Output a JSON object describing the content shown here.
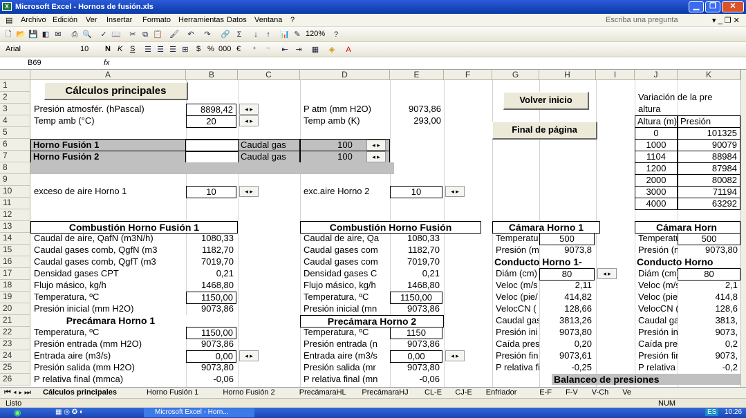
{
  "window": {
    "title": "Microsoft Excel - Hornos de fusión.xls",
    "min": "▁",
    "max": "❐",
    "close": "✕"
  },
  "menu": [
    "Archivo",
    "Edición",
    "Ver",
    "Insertar",
    "Formato",
    "Herramientas",
    "Datos",
    "Ventana",
    "?"
  ],
  "help_placeholder": "Escriba una pregunta",
  "toolbar": {
    "zoom": "120%",
    "icons": [
      "new-icon",
      "open-icon",
      "save-icon",
      "permission-icon",
      "email-icon",
      "print-icon",
      "print-preview-icon",
      "spelling-icon",
      "research-icon",
      "cut-icon",
      "copy-icon",
      "paste-icon",
      "format-painter-icon",
      "undo-icon",
      "redo-icon",
      "hyperlink-icon",
      "sum-icon",
      "sort-asc-icon",
      "sort-desc-icon",
      "chart-icon",
      "drawing-icon"
    ]
  },
  "format": {
    "font": "Arial",
    "size": "10",
    "bold": "N",
    "italic": "K",
    "underline": "S",
    "currency": "$",
    "percent": "%",
    "thousands": "000",
    "euro": "€"
  },
  "formula": {
    "namebox": "B69",
    "fx": "fx",
    "content": ""
  },
  "columns": [
    "A",
    "B",
    "C",
    "D",
    "E",
    "F",
    "G",
    "H",
    "I",
    "J",
    "K"
  ],
  "rows": [
    "1",
    "2",
    "3",
    "4",
    "5",
    "6",
    "7",
    "8",
    "9",
    "10",
    "11",
    "12",
    "13",
    "14",
    "15",
    "16",
    "17",
    "18",
    "19",
    "20",
    "21",
    "22",
    "23",
    "24",
    "25",
    "26"
  ],
  "cells": {
    "title": "Cálculos principales",
    "volver": "Volver inicio",
    "final": "Final de página",
    "a3": "Presión atmosfér. (hPascal)",
    "b3": "8898,42",
    "d3": "P atm (mm H2O)",
    "e3": "9073,86",
    "a4": "Temp amb (°C)",
    "b4": "20",
    "d4": "Temp amb (K)",
    "e4": "293,00",
    "a6": "Horno Fusión 1",
    "c6": "Caudal gas",
    "e6": "100",
    "a7": "Horno Fusión 2",
    "c7": "Caudal gas",
    "e7": "100",
    "a10": "exceso de aire Horno 1",
    "b10": "10",
    "d10": "exc.aire Horno 2",
    "e10": "10",
    "j2": "Variación de la pre",
    "j3": "altura",
    "j4": "Altura (m)",
    "k4": "Presión",
    "j_vals": [
      "0",
      "1000",
      "1104",
      "1200",
      "2000",
      "3000",
      "4000"
    ],
    "k_vals": [
      "101325",
      "90079",
      "88984",
      "87984",
      "80082",
      "71194",
      "63292"
    ],
    "a13": "Combustión Horno Fusión 1",
    "d13": "Combustión Horno Fusión",
    "a14": "Caudal de aire, QafN (m3N/h)",
    "b14": "1080,33",
    "d14": "Caudal de aire, Qa",
    "e14": "1080,33",
    "a15": "Caudal gases comb, QgfN (m3",
    "b15": "1182,70",
    "d15": "Caudal gases com",
    "e15": "1182,70",
    "a16": "Caudal gases comb, QgfT (m3",
    "b16": "7019,70",
    "d16": "Caudal gases com",
    "e16": "7019,70",
    "a17": "Densidad gases CPT",
    "b17": "0,21",
    "d17": "Densidad gases C",
    "e17": "0,21",
    "a18": "Flujo másico, kg/h",
    "b18": "1468,80",
    "d18": "Flujo másico, kg/h",
    "e18": "1468,80",
    "a19": "Temperatura, ºC",
    "b19": "1150,00",
    "d19": "Temperatura, ºC",
    "e19": "1150,00",
    "a20": "Presión inicial (mm H2O)",
    "b20": "9073,86",
    "d20": "Presión inicial (mn",
    "e20": "9073,86",
    "a21": "Precámara Horno 1",
    "d21": "Precámara Horno 2",
    "a22": "Temperatura, ºC",
    "b22": "1150,00",
    "d22": "Temperatura, ºC",
    "e22": "1150",
    "a23": "Presión entrada (mm H2O)",
    "b23": "9073,86",
    "d23": "Presión entrada (n",
    "e23": "9073,86",
    "a24": "Entrada aire (m3/s)",
    "b24": "0,00",
    "d24": "Entrada aire (m3/s",
    "e24": "0,00",
    "a25": "Presión salida (mm H2O)",
    "b25": "9073,80",
    "d25": "Presión salida (mr",
    "e25": "9073,80",
    "a26": "P relativa final (mmca)",
    "b26": "-0,06",
    "d26": "P relativa final (mn",
    "e26": "-0,06",
    "g13": "Cámara Horno 1",
    "j13": "Cámara Horn",
    "g14": "Temperatu",
    "h14": "500",
    "j14": "Temperatu",
    "k14": "500",
    "g15": "Presión (m",
    "h15": "9073,8",
    "j15": "Presión (m",
    "k15": "9073,80",
    "g16": "Conducto Horno 1-",
    "j16": "Conducto Horno",
    "g17": "Diám (cm)",
    "h17": "80",
    "j17": "Diám (cm)",
    "k17": "80",
    "g18": "Veloc (m/s",
    "h18": "2,11",
    "j18": "Veloc (m/s",
    "k18": "2,1",
    "g19": "Veloc (pie/",
    "h19": "414,82",
    "j19": "Veloc (pie/",
    "k19": "414,8",
    "g20": "VelocCN (",
    "h20": "128,66",
    "j20": "VelocCN (",
    "k20": "128,6",
    "g21": "Caudal gas",
    "h21": "3813,26",
    "j21": "Caudal ga:",
    "k21": "3813,",
    "g22": "Presión ini",
    "h22": "9073,80",
    "j22": "Presión ini",
    "k22": "9073,",
    "g23": "Caída pres",
    "h23": "0,20",
    "j23": "Caída pres",
    "k23": "0,2",
    "g24": "Presión fin",
    "h24": "9073,61",
    "j24": "Presión fin",
    "k24": "9073,",
    "g25": "P relativa fi",
    "h25": "-0,25",
    "j25": "P relativa f",
    "k25": "-0,2",
    "balanceo": "Balanceo de presiones"
  },
  "sheets": [
    "Cálculos principales",
    "Horno Fusión 1",
    "Horno Fusión 2",
    "PrecámaraHL",
    "PrecámaraHJ",
    "CL-E",
    "CJ-E",
    "Enfriador",
    "E-F",
    "F-V",
    "V-Ch",
    "Ve"
  ],
  "status": {
    "left": "Listo",
    "num": "NUM"
  },
  "taskbar": {
    "app": "Microsoft Excel - Horn...",
    "lang": "ES",
    "time": "10:26"
  }
}
